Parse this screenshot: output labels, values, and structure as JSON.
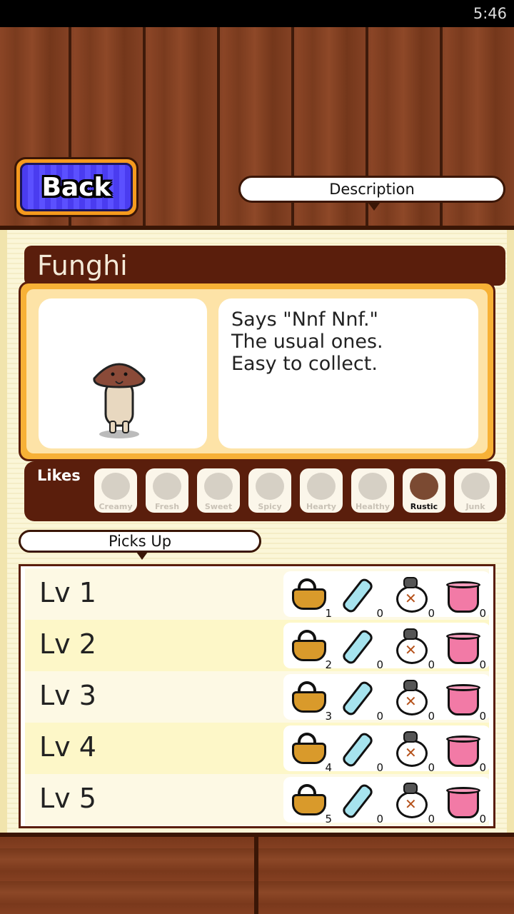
{
  "status_bar": {
    "time": "5:46"
  },
  "header": {
    "back_label": "Back",
    "description_tab": "Description"
  },
  "character": {
    "name": "Funghi",
    "description_lines": [
      "Says \"Nnf Nnf.\"",
      "The usual ones.",
      "Easy to collect."
    ]
  },
  "likes": {
    "label": "Likes",
    "items": [
      {
        "label": "Creamy",
        "active": false
      },
      {
        "label": "Fresh",
        "active": false
      },
      {
        "label": "Sweet",
        "active": false
      },
      {
        "label": "Spicy",
        "active": false
      },
      {
        "label": "Hearty",
        "active": false
      },
      {
        "label": "Healthy",
        "active": false
      },
      {
        "label": "Rustic",
        "active": true
      },
      {
        "label": "Junk",
        "active": false
      }
    ]
  },
  "picks_up": {
    "label": "Picks Up",
    "item_icons": [
      "basket-icon",
      "bottle-icon",
      "bag-icon",
      "bucket-icon"
    ],
    "rows": [
      {
        "level": "Lv 1",
        "counts": [
          "1",
          "0",
          "0",
          "0"
        ]
      },
      {
        "level": "Lv 2",
        "counts": [
          "2",
          "0",
          "0",
          "0"
        ]
      },
      {
        "level": "Lv 3",
        "counts": [
          "3",
          "0",
          "0",
          "0"
        ]
      },
      {
        "level": "Lv 4",
        "counts": [
          "4",
          "0",
          "0",
          "0"
        ]
      },
      {
        "level": "Lv 5",
        "counts": [
          "5",
          "0",
          "0",
          "0"
        ]
      }
    ]
  },
  "colors": {
    "wood": "#7b3b1f",
    "panel": "#fbf6d8",
    "back_button": "#4a3cf0",
    "name_bar": "#5a1e0c",
    "card": "#f7b136"
  }
}
